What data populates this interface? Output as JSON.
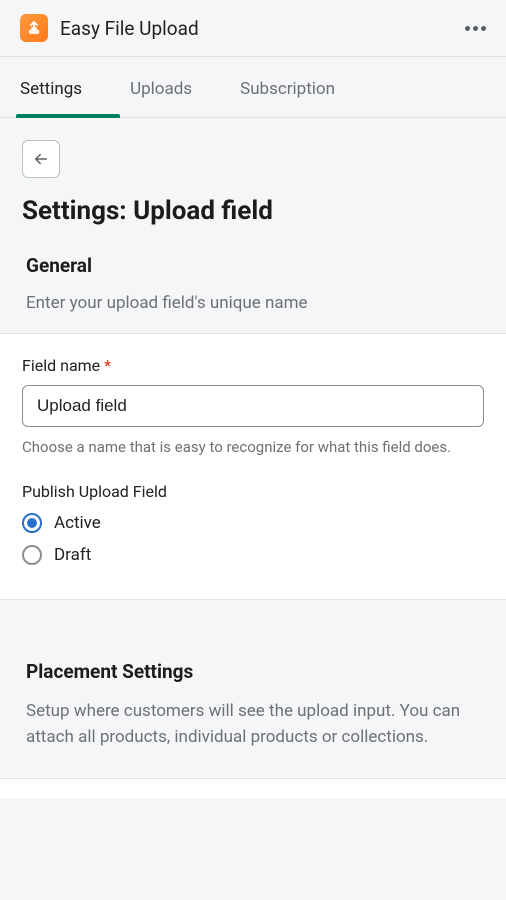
{
  "header": {
    "app_title": "Easy File Upload"
  },
  "tabs": {
    "settings": "Settings",
    "uploads": "Uploads",
    "subscription": "Subscription"
  },
  "page": {
    "title": "Settings: Upload field"
  },
  "general": {
    "title": "General",
    "description": "Enter your upload field's unique name",
    "field_name_label": "Field name",
    "field_name_value": "Upload field",
    "field_name_help": "Choose a name that is easy to recognize for what this field does.",
    "publish_label": "Publish Upload Field",
    "publish_options": {
      "active": "Active",
      "draft": "Draft"
    },
    "publish_selected": "active"
  },
  "placement": {
    "title": "Placement Settings",
    "description": "Setup where customers will see the upload input. You can attach all products, individual products or collections."
  }
}
